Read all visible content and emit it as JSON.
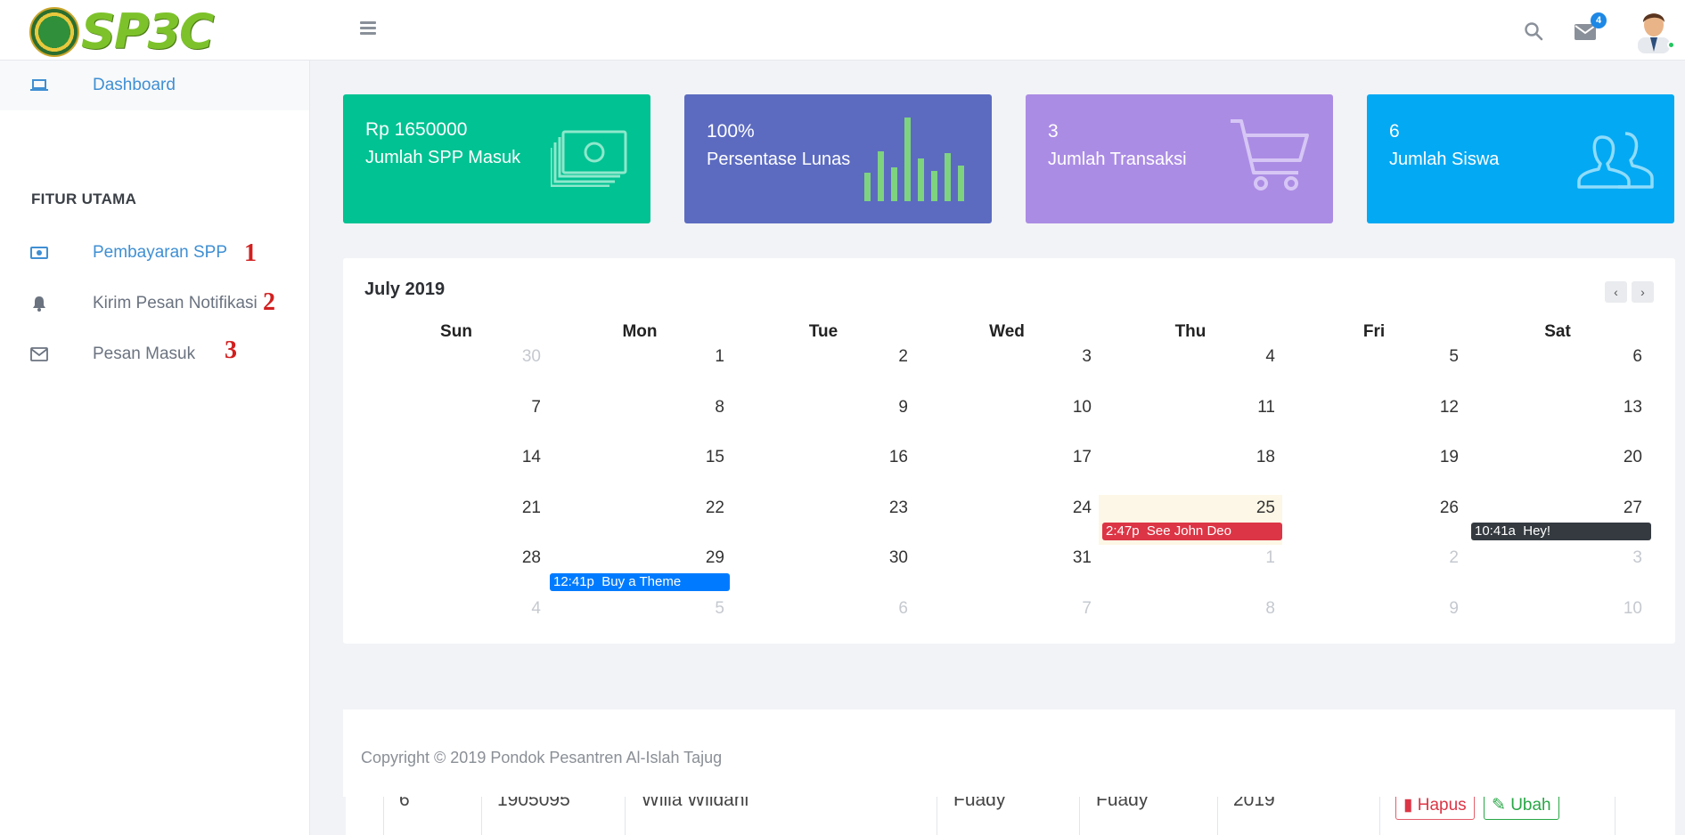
{
  "brand": {
    "logo_text": "SP3C"
  },
  "header": {
    "mail_badge": "4"
  },
  "sidebar": {
    "dashboard": "Dashboard",
    "section_heading": "FITUR UTAMA",
    "items": [
      {
        "label": "Pembayaran SPP",
        "annotation": "1"
      },
      {
        "label": "Kirim Pesan Notifikasi",
        "annotation": "2"
      },
      {
        "label": "Pesan Masuk",
        "annotation": "3"
      }
    ]
  },
  "stats": [
    {
      "value": "Rp 1650000",
      "caption": "Jumlah SPP Masuk",
      "color": "#00c292",
      "icon": "money-icon"
    },
    {
      "value": "100%",
      "caption": "Persentase Lunas",
      "color": "#5c6bc0",
      "icon": "bar-chart-icon"
    },
    {
      "value": "3",
      "caption": "Jumlah Transaksi",
      "color": "#ab8ce4",
      "icon": "cart-icon"
    },
    {
      "value": "6",
      "caption": "Jumlah Siswa",
      "color": "#03a9f3",
      "icon": "users-icon"
    }
  ],
  "calendar": {
    "title": "July 2019",
    "prev": "‹",
    "next": "›",
    "days": [
      "Sun",
      "Mon",
      "Tue",
      "Wed",
      "Thu",
      "Fri",
      "Sat"
    ],
    "weeks": [
      [
        "30",
        "1",
        "2",
        "3",
        "4",
        "5",
        "6"
      ],
      [
        "7",
        "8",
        "9",
        "10",
        "11",
        "12",
        "13"
      ],
      [
        "14",
        "15",
        "16",
        "17",
        "18",
        "19",
        "20"
      ],
      [
        "21",
        "22",
        "23",
        "24",
        "25",
        "26",
        "27"
      ],
      [
        "28",
        "29",
        "30",
        "31",
        "1",
        "2",
        "3"
      ],
      [
        "4",
        "5",
        "6",
        "7",
        "8",
        "9",
        "10"
      ]
    ],
    "events": [
      {
        "time": "2:47p",
        "title": "See John Deo",
        "color": "#dc3545"
      },
      {
        "time": "10:41a",
        "title": "Hey!",
        "color": "#343a40"
      },
      {
        "time": "12:41p",
        "title": "Buy a Theme",
        "color": "#007bff"
      }
    ]
  },
  "footer": {
    "copyright": "Copyright © 2019 Pondok Pesantren Al-Islah Tajug"
  },
  "table_peek": {
    "cells": [
      "6",
      "1905095",
      "Willa Wildani",
      "Fuady",
      "Fuady",
      "2019"
    ],
    "delete_label": "Hapus",
    "edit_label": "Ubah"
  }
}
